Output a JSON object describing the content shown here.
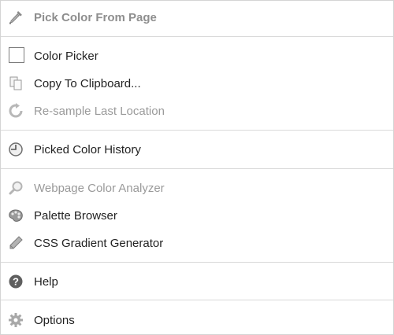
{
  "menu": {
    "pick_color": {
      "label": "Pick Color From Page",
      "icon": "eyedropper-icon"
    },
    "color_picker": {
      "label": "Color Picker",
      "icon": "checkbox"
    },
    "copy_clipboard": {
      "label": "Copy To Clipboard...",
      "icon": "clipboard-pages-icon"
    },
    "resample": {
      "label": "Re-sample Last Location",
      "icon": "refresh-icon"
    },
    "history": {
      "label": "Picked Color History",
      "icon": "clock-icon"
    },
    "analyzer": {
      "label": "Webpage Color Analyzer",
      "icon": "magnifier-icon"
    },
    "palette": {
      "label": "Palette Browser",
      "icon": "palette-icon"
    },
    "gradient": {
      "label": "CSS Gradient Generator",
      "icon": "pencil-icon"
    },
    "help": {
      "label": "Help",
      "icon": "help-icon"
    },
    "options": {
      "label": "Options",
      "icon": "gear-icon"
    }
  }
}
